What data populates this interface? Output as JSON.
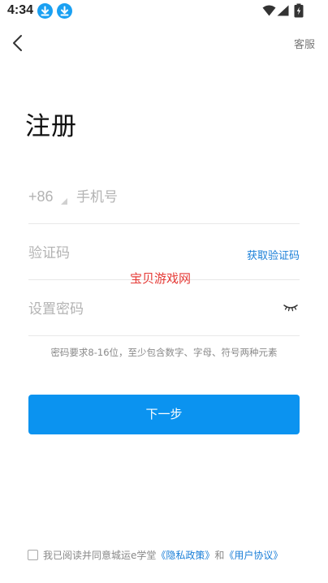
{
  "status_bar": {
    "time": "4:34",
    "icons": [
      "download-icon",
      "download-icon",
      "wifi-icon",
      "signal-icon",
      "battery-icon"
    ]
  },
  "header": {
    "back_icon": "back-arrow-icon",
    "service_label": "客服"
  },
  "title": "注册",
  "phone_field": {
    "country_code": "+86",
    "placeholder": "手机号",
    "value": ""
  },
  "code_field": {
    "placeholder": "验证码",
    "value": "",
    "get_code_label": "获取验证码"
  },
  "password_field": {
    "placeholder": "设置密码",
    "value": "",
    "toggle_icon": "eye-closed-icon"
  },
  "watermark": "宝贝游戏网",
  "password_hint": "密码要求8-16位，至少包含数字、字母、符号两种元素",
  "next_button_label": "下一步",
  "agreement": {
    "checked": false,
    "prefix": "我已阅读并同意城运e学堂",
    "privacy_link": "《隐私政策》",
    "and": "和",
    "user_link": "《用户协议》"
  },
  "colors": {
    "accent": "#0b93f0",
    "link": "#1a7fd8",
    "watermark": "#e53935",
    "status_icon_blue": "#1aa0f2"
  }
}
